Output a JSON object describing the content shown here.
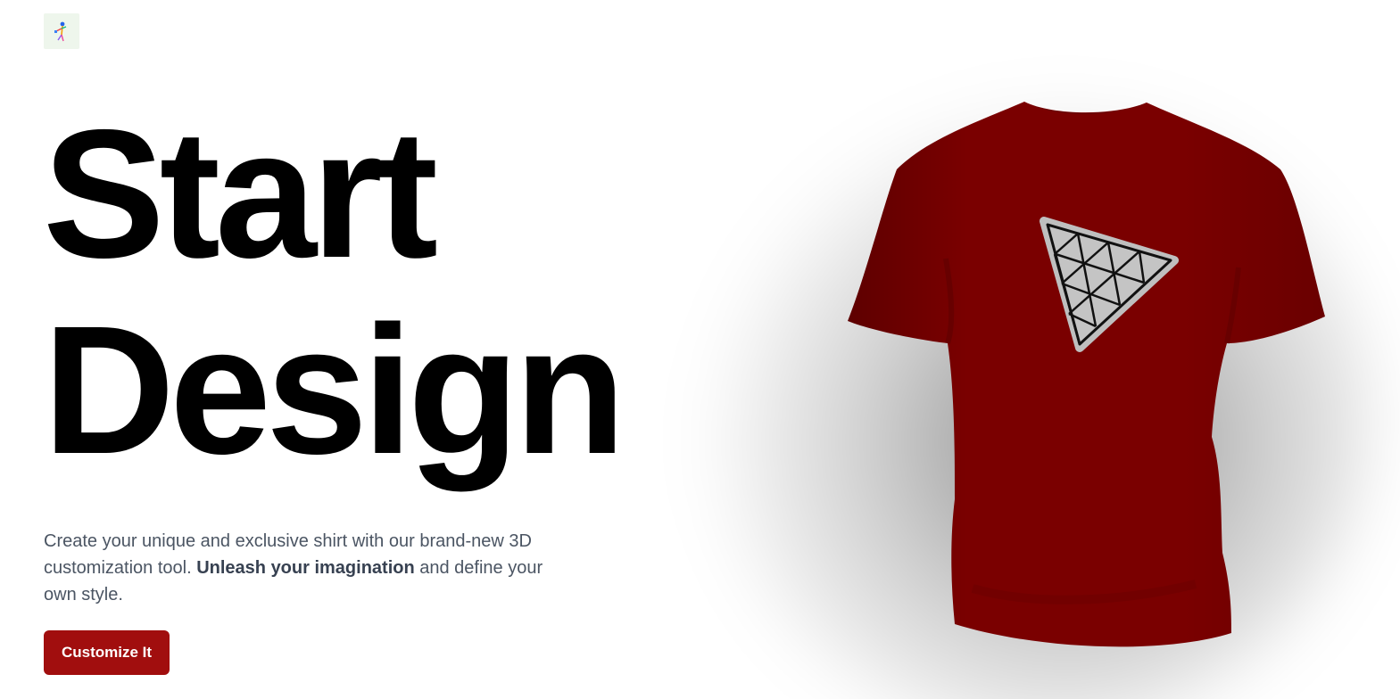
{
  "header": {
    "logo_icon": "threejs-stickman-logo-icon"
  },
  "hero": {
    "title_line1": "Start",
    "title_line2": "Design",
    "description_part1": "Create your unique and exclusive shirt with our brand-new 3D customization tool.",
    "description_bold": "Unleash your imagination",
    "description_part2": "and define your own style.",
    "cta_label": "Customize It"
  },
  "shirt": {
    "color": "#7a0000",
    "decal_icon": "triangle-mesh-logo-icon"
  },
  "colors": {
    "accent": "#a10e0e",
    "text_muted": "#4b5563"
  }
}
